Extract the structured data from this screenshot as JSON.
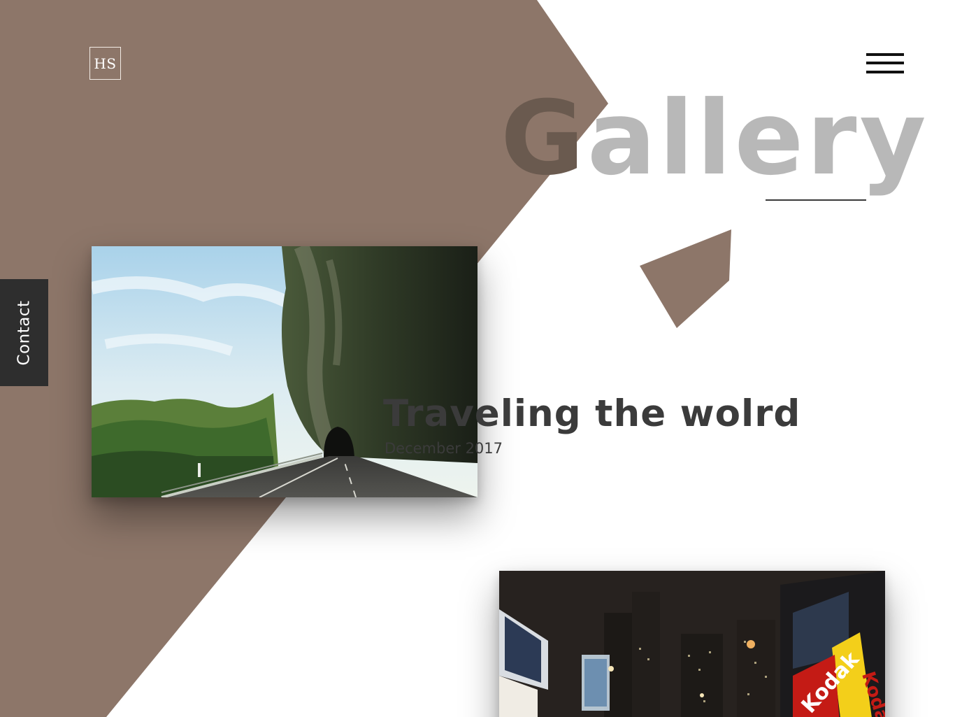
{
  "brand": {
    "logo_text": "HS"
  },
  "header": {
    "menu_icon": "hamburger-menu-icon"
  },
  "gallery": {
    "title_first": "G",
    "title_rest": "allery"
  },
  "side_tab": {
    "label": "Contact"
  },
  "post": {
    "title": "Traveling the wolrd",
    "date": "December 2017"
  },
  "photos": [
    {
      "subject": "mountain road tunnel"
    },
    {
      "subject": "city at night with Kodak signs",
      "sign_text": "Kodak"
    }
  ],
  "colors": {
    "accent_brown": "#8d7669",
    "dark": "#2e2e2e",
    "title_gray": "#b8b8b8",
    "title_dark": "#6a5a4f"
  }
}
